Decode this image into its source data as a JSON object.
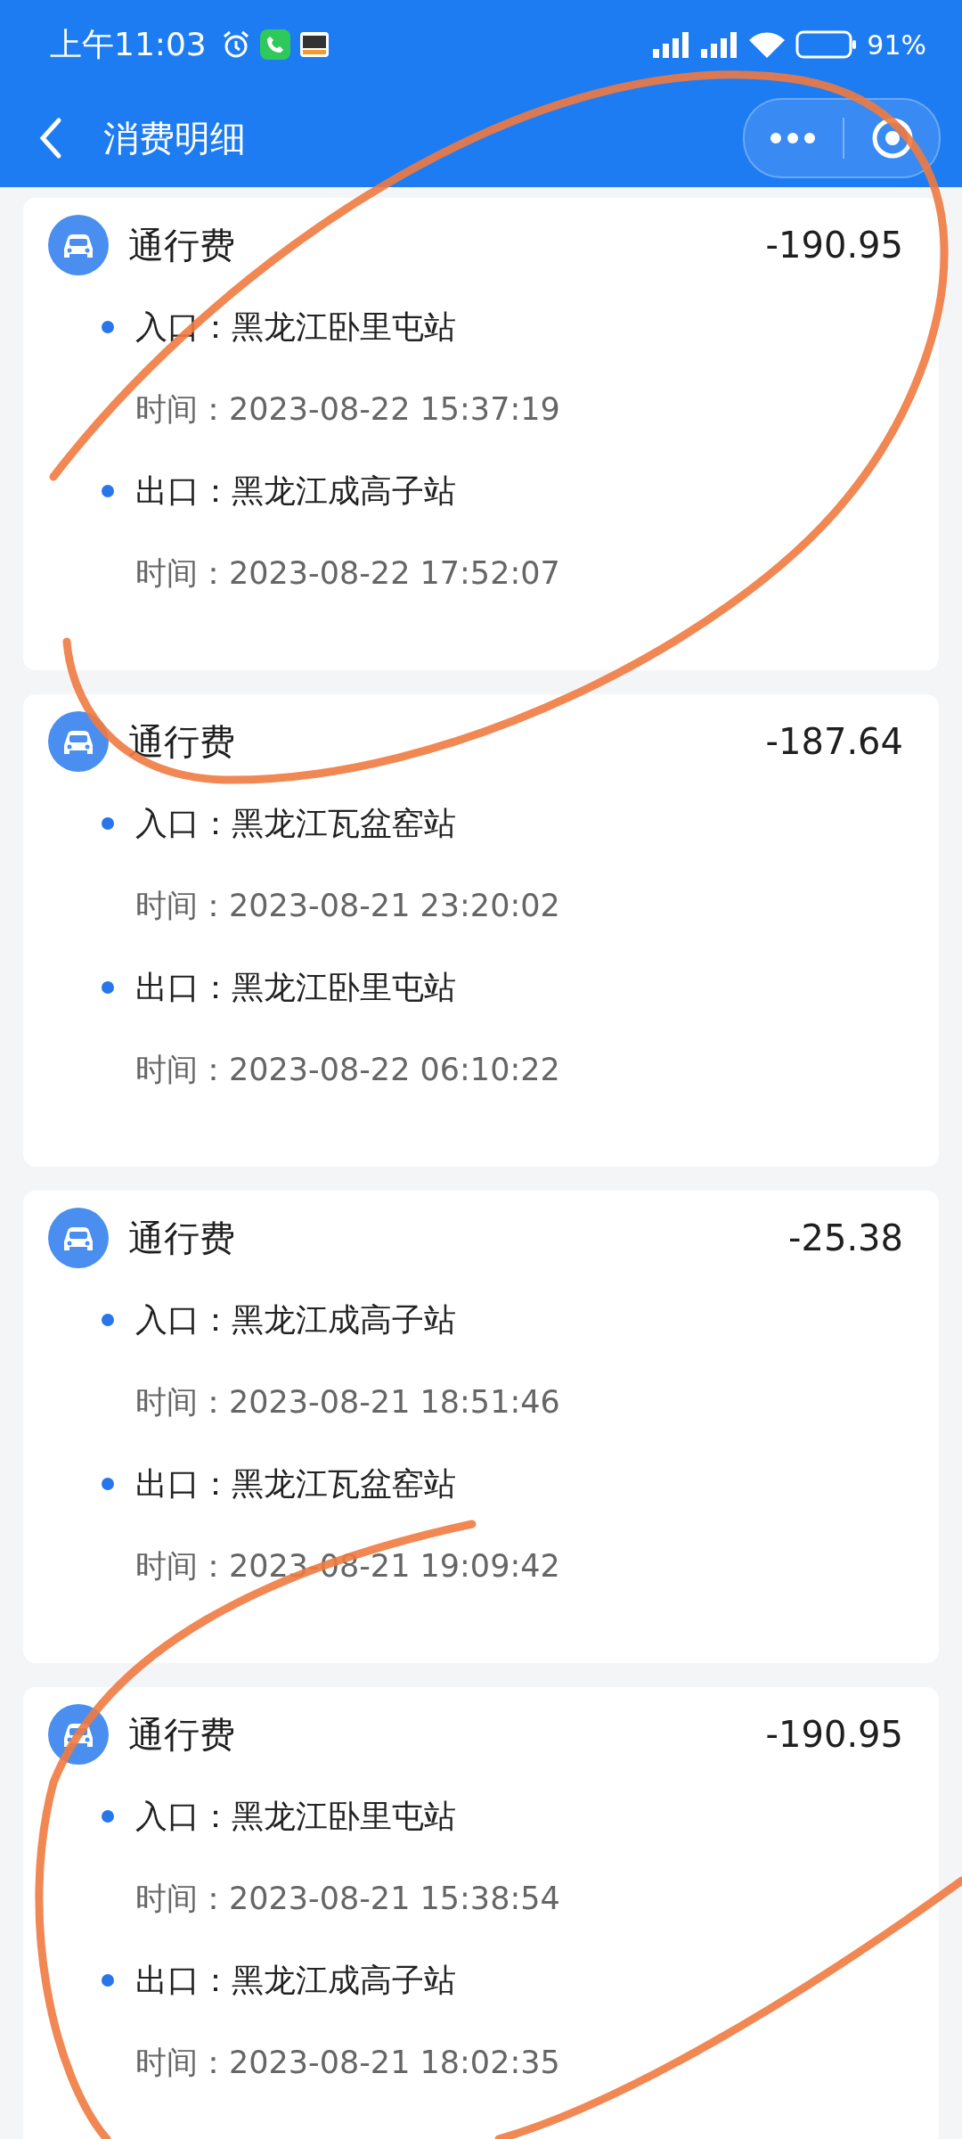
{
  "status_bar": {
    "time": "上午11:03",
    "battery": "91%"
  },
  "nav": {
    "title": "消费明细"
  },
  "records": [
    {
      "title": "通行费",
      "amount": "-190.95",
      "rows": [
        {
          "kind": "station",
          "text": "入口：黑龙江卧里屯站"
        },
        {
          "kind": "time",
          "text": "时间：2023-08-22 15:37:19"
        },
        {
          "kind": "station",
          "text": "出口：黑龙江成高子站"
        },
        {
          "kind": "time",
          "text": "时间：2023-08-22 17:52:07"
        }
      ]
    },
    {
      "title": "通行费",
      "amount": "-187.64",
      "rows": [
        {
          "kind": "station",
          "text": "入口：黑龙江瓦盆窑站"
        },
        {
          "kind": "time",
          "text": "时间：2023-08-21 23:20:02"
        },
        {
          "kind": "station",
          "text": "出口：黑龙江卧里屯站"
        },
        {
          "kind": "time",
          "text": "时间：2023-08-22 06:10:22"
        }
      ]
    },
    {
      "title": "通行费",
      "amount": "-25.38",
      "rows": [
        {
          "kind": "station",
          "text": "入口：黑龙江成高子站"
        },
        {
          "kind": "time",
          "text": "时间：2023-08-21 18:51:46"
        },
        {
          "kind": "station",
          "text": "出口：黑龙江瓦盆窑站"
        },
        {
          "kind": "time",
          "text": "时间：2023-08-21 19:09:42"
        }
      ]
    },
    {
      "title": "通行费",
      "amount": "-190.95",
      "rows": [
        {
          "kind": "station",
          "text": "入口：黑龙江卧里屯站"
        },
        {
          "kind": "time",
          "text": "时间：2023-08-21 15:38:54"
        },
        {
          "kind": "station",
          "text": "出口：黑龙江成高子站"
        },
        {
          "kind": "time",
          "text": "时间：2023-08-21 18:02:35"
        }
      ]
    }
  ]
}
